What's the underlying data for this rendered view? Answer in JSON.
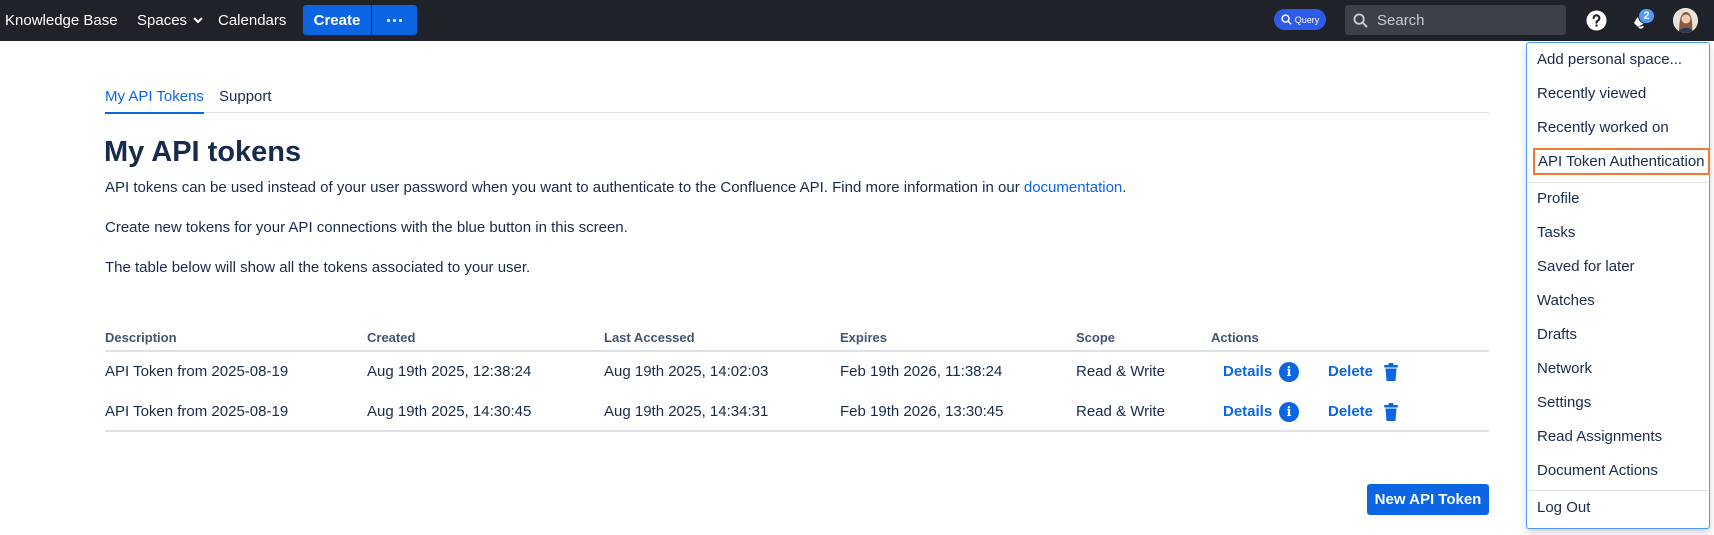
{
  "topbar": {
    "brand": "Knowledge Base",
    "nav": {
      "spaces": "Spaces",
      "calendars": "Calendars"
    },
    "create_label": "Create",
    "query_label": "Query",
    "search_placeholder": "Search",
    "notifications_count": "2"
  },
  "tabs": [
    {
      "label": "My API Tokens",
      "active": true
    },
    {
      "label": "Support",
      "active": false
    }
  ],
  "page": {
    "title": "My API tokens",
    "intro_text": "API tokens can be used instead of your user password when you want to authenticate to the Confluence API. Find more information in our ",
    "intro_link": "documentation",
    "intro_end": ".",
    "create_info": "Create new tokens for your API connections with the blue button in this screen.",
    "table_info": "The table below will show all the tokens associated to your user."
  },
  "table": {
    "headers": {
      "description": "Description",
      "created": "Created",
      "last_accessed": "Last Accessed",
      "expires": "Expires",
      "scope": "Scope",
      "actions": "Actions"
    },
    "rows": [
      {
        "description": "API Token from 2025-08-19",
        "created": "Aug 19th 2025, 12:38:24",
        "last_accessed": "Aug 19th 2025, 14:02:03",
        "expires": "Feb 19th 2026, 11:38:24",
        "scope": "Read & Write",
        "details": "Details",
        "delete": "Delete"
      },
      {
        "description": "API Token from 2025-08-19",
        "created": "Aug 19th 2025, 14:30:45",
        "last_accessed": "Aug 19th 2025, 14:34:31",
        "expires": "Feb 19th 2026, 13:30:45",
        "scope": "Read & Write",
        "details": "Details",
        "delete": "Delete"
      }
    ]
  },
  "new_token_button": "New API Token",
  "menu": {
    "group1": [
      "Add personal space...",
      "Recently viewed",
      "Recently worked on",
      "API Token Authentication"
    ],
    "group2": [
      "Profile",
      "Tasks",
      "Saved for later",
      "Watches",
      "Drafts",
      "Network",
      "Settings",
      "Read Assignments",
      "Document Actions"
    ],
    "group3": [
      "Log Out"
    ]
  },
  "colors": {
    "topbar": "#1f2228",
    "accent": "#0c66e4",
    "highlight_border": "#f07a34"
  }
}
